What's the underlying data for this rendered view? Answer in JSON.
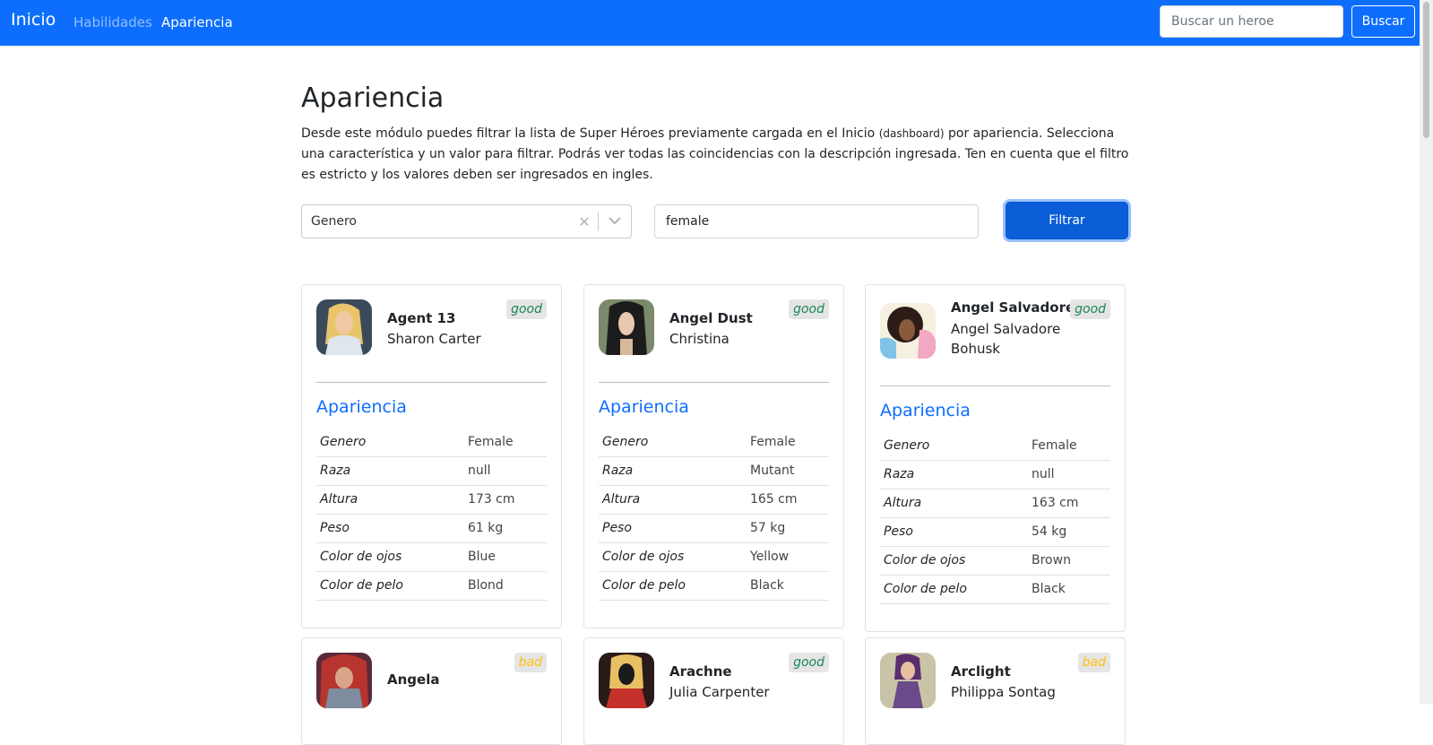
{
  "navbar": {
    "brand": "Inicio",
    "links": [
      "Habilidades",
      "Apariencia"
    ],
    "search_placeholder": "Buscar un heroe",
    "search_button": "Buscar",
    "colors": {
      "background": "#0d6efd",
      "text": "#ffffff"
    }
  },
  "page": {
    "title": "Apariencia",
    "description_before": "Desde este módulo puedes filtrar la lista de Super Héroes previamente cargada en el Inicio ",
    "description_small": "(dashboard)",
    "description_after": " por apariencia. Selecciona una característica y un valor para filtrar. Podrás ver todas las coincidencias con la descripción ingresada. Ten en cuenta que el filtro es estricto y los valores deben ser ingresados en ingles."
  },
  "filter": {
    "selected_attribute": "Genero",
    "value": "female",
    "button": "Filtrar"
  },
  "section_title": "Apariencia",
  "attribute_labels": [
    "Genero",
    "Raza",
    "Altura",
    "Peso",
    "Color de ojos",
    "Color de pelo"
  ],
  "heroes": [
    {
      "name": "Agent 13",
      "real_name": "Sharon Carter",
      "alignment": "good",
      "attributes": [
        "Female",
        "null",
        "173 cm",
        "61 kg",
        "Blue",
        "Blond"
      ]
    },
    {
      "name": "Angel Dust",
      "real_name": "Christina",
      "alignment": "good",
      "attributes": [
        "Female",
        "Mutant",
        "165 cm",
        "57 kg",
        "Yellow",
        "Black"
      ]
    },
    {
      "name": "Angel Salvadore",
      "real_name": "Angel Salvadore Bohusk",
      "alignment": "good",
      "attributes": [
        "Female",
        "null",
        "163 cm",
        "54 kg",
        "Brown",
        "Black"
      ]
    },
    {
      "name": "Angela",
      "real_name": "",
      "alignment": "bad"
    },
    {
      "name": "Arachne",
      "real_name": "Julia Carpenter",
      "alignment": "good"
    },
    {
      "name": "Arclight",
      "real_name": "Philippa Sontag",
      "alignment": "bad"
    }
  ],
  "alignment_colors": {
    "good": "#198754",
    "bad": "#ffc107"
  },
  "accent_color": "#0d6efd"
}
